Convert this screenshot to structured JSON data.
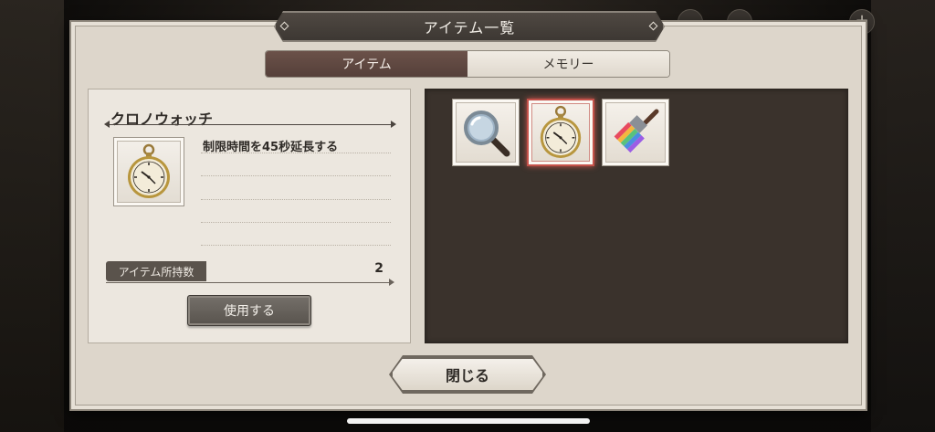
{
  "dialog": {
    "title": "アイテム一覧",
    "close_label": "閉じる"
  },
  "tabs": [
    {
      "label": "アイテム",
      "active": true
    },
    {
      "label": "メモリー",
      "active": false
    }
  ],
  "detail": {
    "item_name": "クロノウォッチ",
    "description": "制限時間を45秒延長する",
    "count_label": "アイテム所持数",
    "count_value": "2",
    "use_label": "使用する"
  },
  "inventory": [
    {
      "icon": "magnifying-glass-icon",
      "selected": false
    },
    {
      "icon": "pocket-watch-icon",
      "selected": true
    },
    {
      "icon": "paint-brush-icon",
      "selected": false
    }
  ],
  "colors": {
    "selected_border": "#c4524a",
    "active_tab": "#5f4740",
    "grid_bg": "#3a322c"
  }
}
